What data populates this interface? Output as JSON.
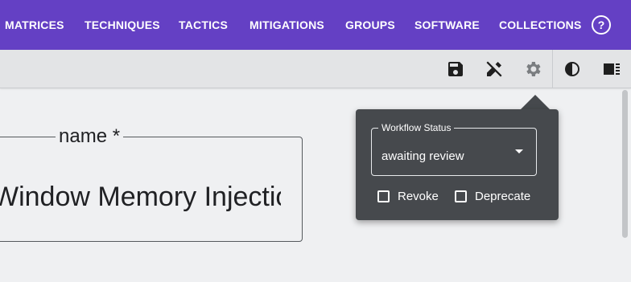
{
  "nav": {
    "items": [
      {
        "label": "MATRICES"
      },
      {
        "label": "TECHNIQUES"
      },
      {
        "label": "TACTICS"
      },
      {
        "label": "MITIGATIONS"
      },
      {
        "label": "GROUPS"
      },
      {
        "label": "SOFTWARE"
      },
      {
        "label": "COLLECTIONS"
      }
    ],
    "help_icon": "?"
  },
  "toolbar": {
    "icons": [
      "save-icon",
      "edit-off-icon",
      "gear-icon",
      "contrast-icon",
      "sidebar-toggle-icon"
    ]
  },
  "name_field": {
    "label": "name *",
    "value": "Window Memory Injection"
  },
  "workflow_popover": {
    "status_label": "Workflow Status",
    "status_value": "awaiting review",
    "revoke_label": "Revoke",
    "deprecate_label": "Deprecate"
  },
  "colors": {
    "nav_background": "#6440c4",
    "popover_background": "#46494d",
    "page_background": "#eff0f2"
  }
}
